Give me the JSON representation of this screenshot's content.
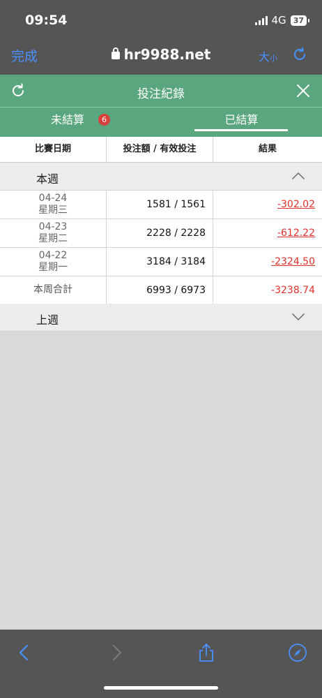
{
  "status": {
    "time": "09:54",
    "network": "4G",
    "battery": "37"
  },
  "browser": {
    "done_label": "完成",
    "url": "hr9988.net",
    "text_size_label": "大",
    "text_size_small": "小"
  },
  "panel": {
    "title": "投注紀錄",
    "tabs": [
      {
        "label": "未結算",
        "badge": "6"
      },
      {
        "label": "已結算"
      }
    ]
  },
  "table": {
    "headers": [
      "比賽日期",
      "投注額 / 有效投注",
      "結果"
    ],
    "this_week": {
      "label": "本週",
      "rows": [
        {
          "date": "04-24",
          "weekday": "星期三",
          "bet": "1581 / 1561",
          "result": "-302.02"
        },
        {
          "date": "04-23",
          "weekday": "星期二",
          "bet": "2228 / 2228",
          "result": "-612.22"
        },
        {
          "date": "04-22",
          "weekday": "星期一",
          "bet": "3184 / 3184",
          "result": "-2324.50"
        }
      ],
      "total": {
        "label": "本周合計",
        "bet": "6993 / 6973",
        "result": "-3238.74"
      }
    },
    "last_week": {
      "label": "上週"
    }
  },
  "colors": {
    "accent_green": "#5aa67e",
    "loss_red": "#e1302a",
    "link_blue": "#4a90ff"
  },
  "icons": [
    "refresh-icon",
    "close-icon",
    "chevron-up-icon",
    "chevron-down-icon",
    "back-icon",
    "forward-icon",
    "share-icon",
    "compass-icon",
    "lock-icon",
    "reload-icon"
  ]
}
